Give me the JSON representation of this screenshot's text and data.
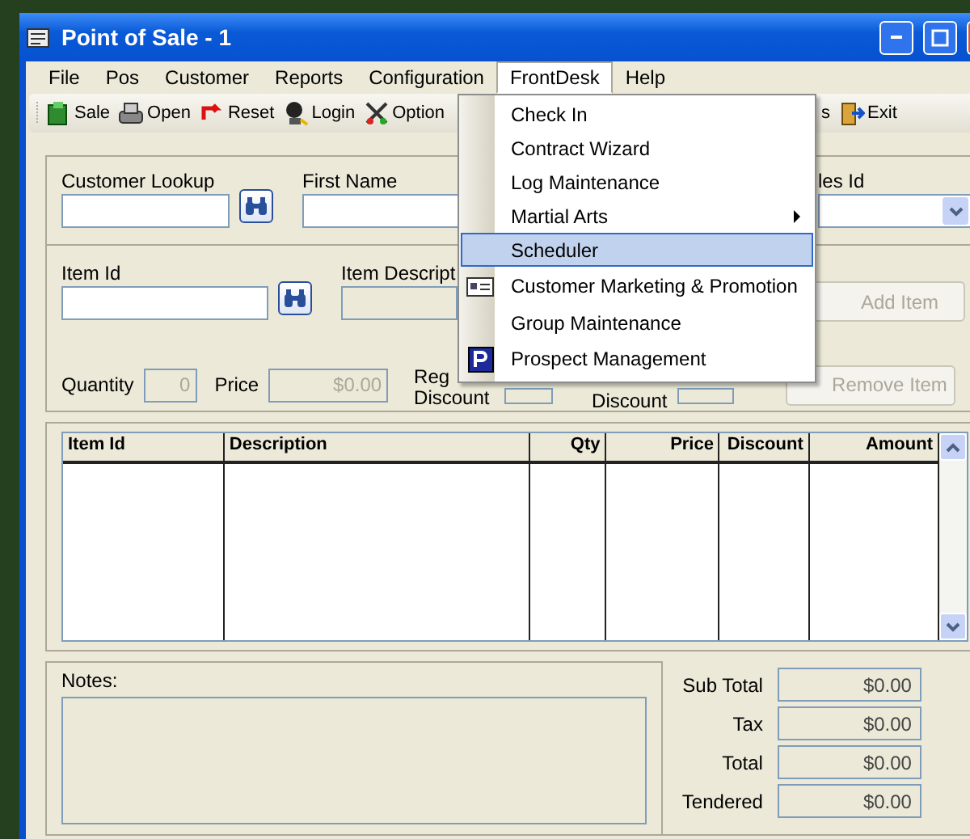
{
  "window": {
    "title": "Point of Sale - 1"
  },
  "menu_bar": [
    {
      "label": "File",
      "selected": false
    },
    {
      "label": "Pos",
      "selected": false
    },
    {
      "label": "Customer",
      "selected": false
    },
    {
      "label": "Reports",
      "selected": false
    },
    {
      "label": "Configuration",
      "selected": false
    },
    {
      "label": "FrontDesk",
      "selected": true
    },
    {
      "label": "Help",
      "selected": false
    }
  ],
  "toolbar": [
    {
      "label": "Sale",
      "kind": "sale"
    },
    {
      "label": "Open",
      "kind": "open"
    },
    {
      "label": "Reset",
      "kind": "reset"
    },
    {
      "label": "Login",
      "kind": "login"
    },
    {
      "label": "Option",
      "kind": "options"
    },
    {
      "label": "s",
      "kind": "plain"
    },
    {
      "label": "Exit",
      "kind": "exit"
    }
  ],
  "customer": {
    "lookup_label": "Customer Lookup",
    "first_name_label": "First Name",
    "sales_id_label": "les Id"
  },
  "item": {
    "item_id_label": "Item Id",
    "description_label": "Item Descript",
    "quantity_label": "Quantity",
    "quantity": "0",
    "price_label": "Price",
    "price": "$0.00",
    "reg_discount_label": "Reg Discount",
    "discount_label": "Discount",
    "buttons": [
      {
        "label": "Add Item",
        "disabled": true
      },
      {
        "label": "Remove Item",
        "disabled": true
      }
    ]
  },
  "grid": {
    "columns": [
      "Item Id",
      "Description",
      "Qty",
      "Price",
      "Discount",
      "Amount"
    ]
  },
  "notes_label": "Notes:",
  "totals": [
    {
      "label": "Sub Total",
      "value": "$0.00"
    },
    {
      "label": "Tax",
      "value": "$0.00"
    },
    {
      "label": "Total",
      "value": "$0.00"
    },
    {
      "label": "Tendered",
      "value": "$0.00"
    }
  ],
  "frontdesk_menu": [
    {
      "label": "Check In",
      "kind": "item",
      "selected": false
    },
    {
      "label": "Contract Wizard",
      "kind": "item",
      "selected": false
    },
    {
      "label": "Log Maintenance",
      "kind": "item",
      "selected": false
    },
    {
      "label": "Martial Arts",
      "kind": "submenu",
      "selected": false
    },
    {
      "label": "Scheduler",
      "kind": "item",
      "selected": true
    },
    {
      "label": "Customer Marketing & Promotion",
      "kind": "card",
      "selected": false
    },
    {
      "label": "Group Maintenance",
      "kind": "item",
      "selected": false
    },
    {
      "label": "Prospect Management",
      "kind": "prospect",
      "selected": false
    }
  ]
}
